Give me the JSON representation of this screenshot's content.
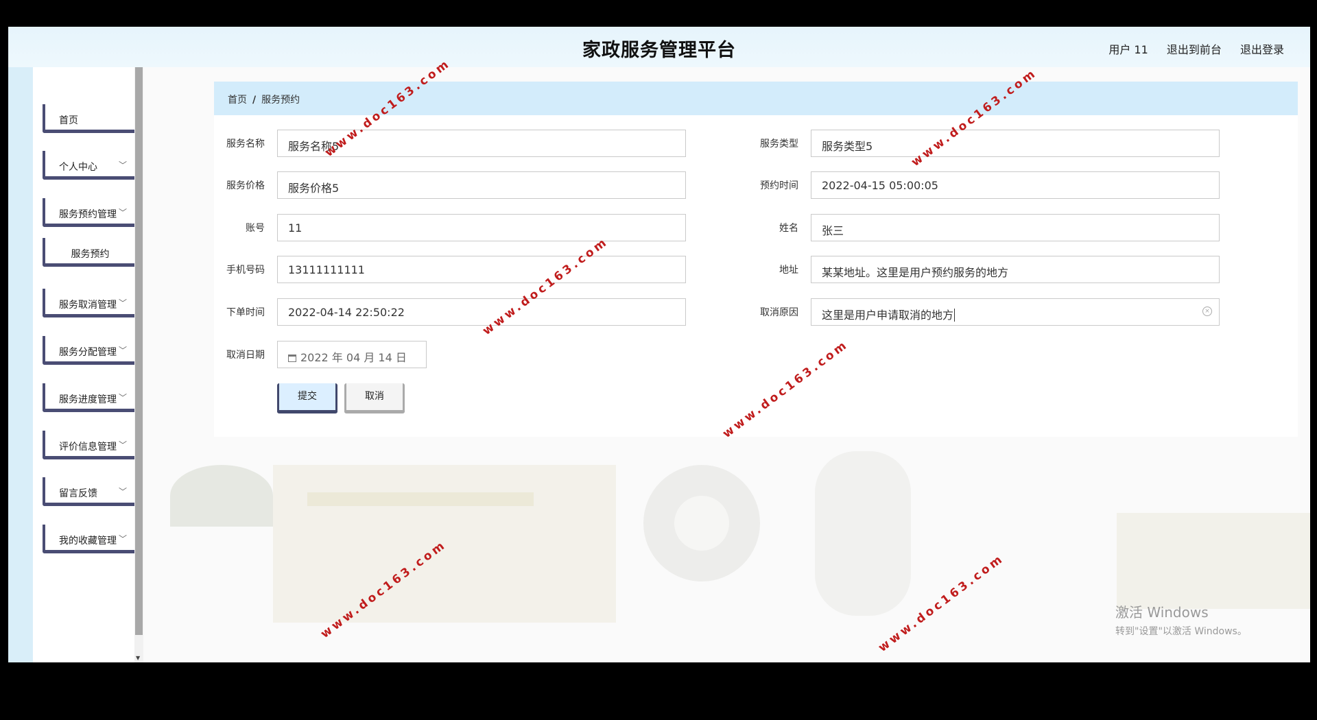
{
  "app": {
    "title": "家政服务管理平台",
    "user_label": "用户 11",
    "to_front_label": "退出到前台",
    "logout_label": "退出登录"
  },
  "sidebar": {
    "items": [
      {
        "label": "首页",
        "has_chevron": false
      },
      {
        "label": "个人中心",
        "has_chevron": true
      },
      {
        "label": "服务预约管理",
        "has_chevron": true
      },
      {
        "label": "服务预约",
        "has_chevron": false,
        "sub": true
      },
      {
        "label": "服务取消管理",
        "has_chevron": true
      },
      {
        "label": "服务分配管理",
        "has_chevron": true
      },
      {
        "label": "服务进度管理",
        "has_chevron": true
      },
      {
        "label": "评价信息管理",
        "has_chevron": true
      },
      {
        "label": "留言反馈",
        "has_chevron": true
      },
      {
        "label": "我的收藏管理",
        "has_chevron": true
      }
    ]
  },
  "breadcrumb": {
    "home": "首页",
    "separator": "/",
    "current": "服务预约"
  },
  "form": {
    "service_name": {
      "label": "服务名称",
      "value": "服务名称5"
    },
    "service_type": {
      "label": "服务类型",
      "value": "服务类型5"
    },
    "service_price": {
      "label": "服务价格",
      "value": "服务价格5"
    },
    "appointment_time": {
      "label": "预约时间",
      "value": "2022-04-15 05:00:05"
    },
    "account": {
      "label": "账号",
      "value": "11"
    },
    "name": {
      "label": "姓名",
      "value": "张三"
    },
    "phone": {
      "label": "手机号码",
      "value": "13111111111"
    },
    "address": {
      "label": "地址",
      "value": "某某地址。这里是用户预约服务的地方"
    },
    "order_time": {
      "label": "下单时间",
      "value": "2022-04-14 22:50:22"
    },
    "cancel_reason": {
      "label": "取消原因",
      "value": "这里是用户申请取消的地方"
    },
    "cancel_date": {
      "label": "取消日期",
      "value": "2022 年 04 月 14 日"
    }
  },
  "buttons": {
    "submit": "提交",
    "cancel": "取消"
  },
  "watermark_text": "www.doc163.com",
  "os_notice": {
    "line1": "激活 Windows",
    "line2": "转到\"设置\"以激活 Windows。"
  },
  "icons": {
    "chevron": "chevron-down-icon",
    "clear": "clear-circle-icon",
    "calendar": "calendar-icon"
  },
  "colors": {
    "topbar": "#e6f4fc",
    "breadcrumb_bg": "#d3ecfb",
    "menu_border": "#4a4d74",
    "watermark": "#c01c1c"
  }
}
